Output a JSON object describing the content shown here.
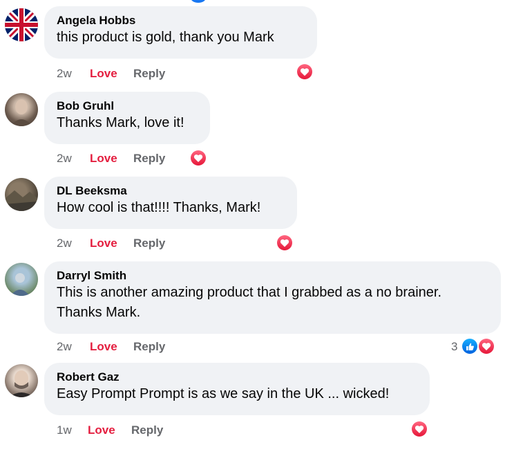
{
  "comments": [
    {
      "author": "Angela Hobbs",
      "text": "this product is gold, thank you Mark",
      "time": "2w",
      "love": "Love",
      "reply": "Reply",
      "avatar": "uk-flag-avatar"
    },
    {
      "author": "Bob Gruhl",
      "text": "Thanks Mark, love it!",
      "time": "2w",
      "love": "Love",
      "reply": "Reply",
      "avatar": "bob-avatar"
    },
    {
      "author": "DL Beeksma",
      "text": "How cool is that!!!! Thanks, Mark!",
      "time": "2w",
      "love": "Love",
      "reply": "Reply",
      "avatar": "dl-avatar"
    },
    {
      "author": "Darryl Smith",
      "text_line1": "This is another amazing product that I grabbed as a no brainer.",
      "text_line2": "Thanks Mark.",
      "time": "2w",
      "love": "Love",
      "reply": "Reply",
      "reaction_count": "3",
      "avatar": "darryl-avatar"
    },
    {
      "author": "Robert Gaz",
      "text": "Easy Prompt Prompt is as we say in the UK ... wicked!",
      "time": "1w",
      "love": "Love",
      "reply": "Reply",
      "avatar": "robert-avatar"
    }
  ],
  "colors": {
    "love": "#e41e3f",
    "bubble": "#f0f2f5",
    "meta": "#65676b",
    "like_blue": "#1877f2"
  }
}
